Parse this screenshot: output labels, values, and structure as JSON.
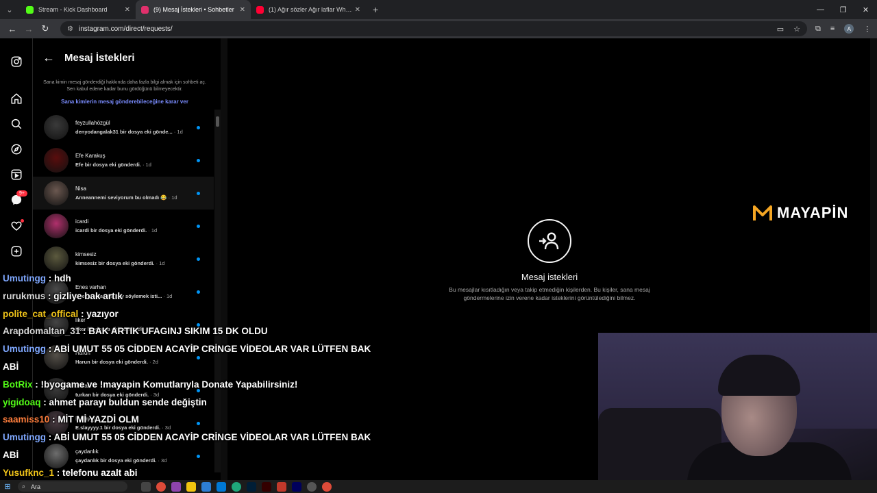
{
  "browser": {
    "tabs": [
      {
        "title": "Stream - Kick Dashboard",
        "active": false,
        "favicon_color": "#53fc18"
      },
      {
        "title": "(9) Mesaj İstekleri • Sohbetler",
        "active": true,
        "favicon_color": "#e1306c"
      },
      {
        "title": "(1) Ağır sözler Ağır laflar Whats",
        "active": false,
        "favicon_color": "#ff0033"
      }
    ],
    "new_tab": "+",
    "url": "instagram.com/direct/requests/"
  },
  "rail": {
    "messages_badge": "9+"
  },
  "requests_panel": {
    "title": "Mesaj İstekleri",
    "info_text": "Sana kimin mesaj gönderdiği hakkında daha fazla bilgi almak için sohbeti aç. Sen kabul edene kadar bunu gördüğünü bilmeyecektir.",
    "policy_link": "Sana kimlerin mesaj gönderebileceğine karar ver",
    "items": [
      {
        "name": "feyzullahözgül",
        "preview": "denyodangalak31 bir dosya eki gönde...",
        "time": "· 1d",
        "avatar_color": "#3a3a3a"
      },
      {
        "name": "Efe Karakuş",
        "preview": "Efe bir dosya eki gönderdi.",
        "time": "· 1d",
        "avatar_color": "#5a0d0d"
      },
      {
        "name": "Nisa",
        "preview": "Anneannemi seviyorum bu olmadı 😂",
        "time": "· 1d",
        "avatar_color": "#6b5850"
      },
      {
        "name": "icardi",
        "preview": "icardi bir dosya eki gönderdi.",
        "time": "· 1d",
        "avatar_color": "#b0306c"
      },
      {
        "name": "kimsesiz",
        "preview": "kimsesiz bir dosya eki gönderdi.",
        "time": "· 1d",
        "avatar_color": "#5c5a3e"
      },
      {
        "name": "Enes varhan",
        "preview": "Enes varhan bir şey söylemek isti...",
        "time": "· 1d",
        "avatar_color": "#4a4a4a"
      },
      {
        "name": "liker",
        "preview": "liker bir dosya eki gönderdi.",
        "time": "· 2d",
        "avatar_color": "#444"
      },
      {
        "name": "Harun",
        "preview": "Harun bir dosya eki gönderdi.",
        "time": "· 2d",
        "avatar_color": "#555049"
      },
      {
        "name": "turkan",
        "preview": "turkan bir dosya eki gönderdi.",
        "time": "· 3d",
        "avatar_color": "#3c3c3c"
      },
      {
        "name": "E.slayyyy",
        "preview": "E.slayyyy.1 bir dosya eki gönderdi.",
        "time": "· 3d",
        "avatar_color": "#4c3c44"
      },
      {
        "name": "çaydanlık",
        "preview": "çaydanlık bir dosya eki gönderdi.",
        "time": "· 3d",
        "avatar_color": "#6d6d6d"
      }
    ]
  },
  "main": {
    "empty_title": "Mesaj istekleri",
    "empty_desc": "Bu mesajlar kısıtladığın veya takip etmediğin kişilerden. Bu kişiler, sana mesaj göndermelerine izin verene kadar isteklerini görüntülediğini bilmez."
  },
  "overlay": {
    "logo_text": "MAYAPİN",
    "chat": [
      {
        "user": "Umutingg",
        "color": "#7fa8ff",
        "text": "hdh"
      },
      {
        "user": "rurukmus",
        "color": "#d8d8d8",
        "text": "gizliye bak artık"
      },
      {
        "user": "polite_cat_offical",
        "color": "#f0c419",
        "text": "yazıyor"
      },
      {
        "user": "Arapdomaltan_31",
        "color": "#d8d8d8",
        "text": "BAK ARTIK UFAGINJ SIKIM 15 DK OLDU"
      },
      {
        "user": "Umutingg",
        "color": "#7fa8ff",
        "text": "ABİ UMUT 55 05 CİDDEN ACAYİP CRİNGE VİDEOLAR VAR LÜTFEN BAK ABİ"
      },
      {
        "user": "BotRix",
        "color": "#53fc18",
        "text": "!byogame ve !mayapin Komutlarıyla Donate Yapabilirsiniz!"
      },
      {
        "user": "yigidoaq",
        "color": "#53fc18",
        "text": "ahmet parayı buldun sende değiştin"
      },
      {
        "user": "saamiss10",
        "color": "#ff7e3c",
        "text": "MİT Mİ YAZDİ OLM"
      },
      {
        "user": "Umutingg",
        "color": "#7fa8ff",
        "text": "ABİ UMUT 55 05 CİDDEN ACAYİP CRİNGE VİDEOLAR VAR LÜTFEN BAK ABİ"
      },
      {
        "user": "Yusufknc_1",
        "color": "#f0c419",
        "text": "telefonu azalt abi"
      }
    ]
  },
  "taskbar": {
    "search_placeholder": "Ara"
  }
}
